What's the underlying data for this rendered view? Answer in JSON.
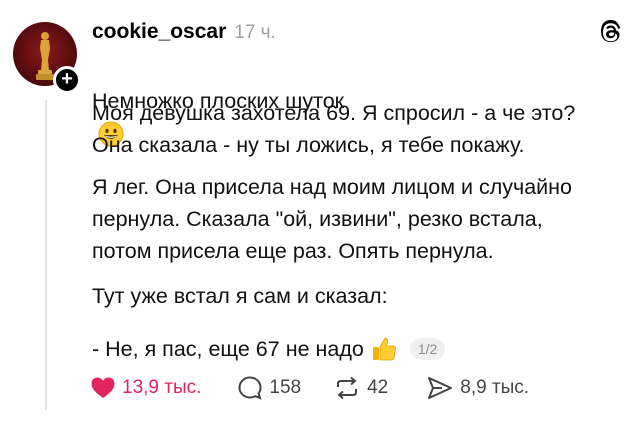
{
  "post": {
    "username": "cookie_oscar",
    "timestamp": "17 ч.",
    "title": "Немножко плоских шуток",
    "paragraphs": [
      "Моя девушка захотела 69. Я спросил - а че это?\nОна сказала - ну ты ложись, я тебе покажу.",
      "Я лег. Она присела над моим лицом и случайно\nпернула. Сказала \"ой, извини\", резко встала,\nпотом присела еще раз. Опять пернула.",
      "Тут уже встал я сам и сказал:",
      "- Не, я пас, еще 67 не надо"
    ],
    "page_indicator": "1/2",
    "title_emoji": "grinning-face",
    "last_line_emoji": "thumbs-up"
  },
  "actions": {
    "likes": "13,9 тыс.",
    "comments": "158",
    "reposts": "42",
    "shares": "8,9 тыс."
  },
  "colors": {
    "like_active": "#e0245e",
    "muted_text": "#a0a0a0",
    "text": "#111111"
  }
}
